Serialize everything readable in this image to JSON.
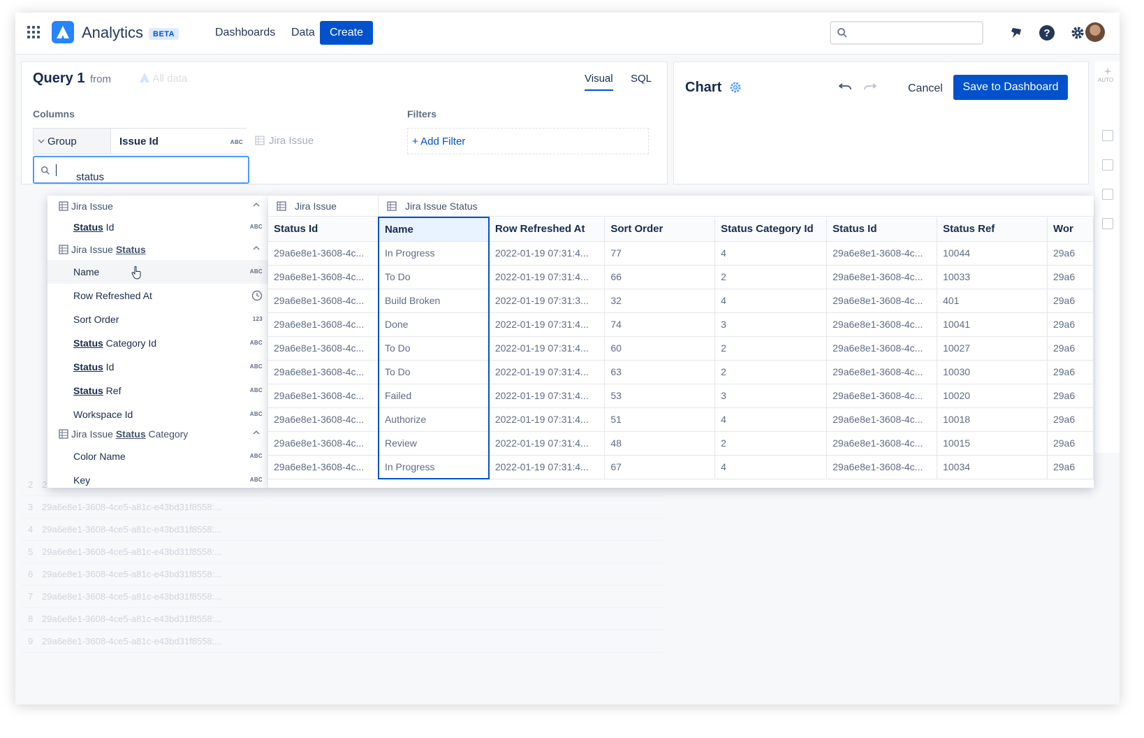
{
  "topbar": {
    "app_title": "Analytics",
    "beta_badge": "BETA",
    "nav": [
      "Dashboards",
      "Data"
    ],
    "create_label": "Create",
    "search_placeholder": ""
  },
  "query": {
    "title": "Query 1",
    "from_label": "from",
    "source_label": "All data",
    "tabs": [
      "Visual",
      "SQL"
    ],
    "active_tab": "Visual",
    "columns_label": "Columns",
    "filters_label": "Filters",
    "group_label": "Group",
    "column_name": "Issue Id",
    "column_type": "ABC",
    "ghost_source": "Jira Issue",
    "add_filter_label": "+ Add Filter",
    "search_value": "status"
  },
  "chart": {
    "title": "Chart",
    "cancel_label": "Cancel",
    "save_label": "Save to Dashboard",
    "rail_auto": "AUTO"
  },
  "dropdown": {
    "groups": [
      {
        "pre": "Jira Issue",
        "hl": "",
        "post": ""
      },
      {
        "pre": "Jira Issue ",
        "hl": "Status",
        "post": ""
      },
      {
        "pre": "Jira Issue ",
        "hl": "Status",
        "post": " Category"
      }
    ],
    "items": [
      {
        "hl": "Status",
        "post": " Id",
        "type": "ABC"
      },
      {
        "hl": "",
        "post": "Name",
        "type": "ABC"
      },
      {
        "hl": "",
        "post": "Row Refreshed At",
        "type": "clock"
      },
      {
        "hl": "",
        "post": "Sort Order",
        "type": "123"
      },
      {
        "hl": "Status",
        "post": " Category Id",
        "type": "ABC"
      },
      {
        "hl": "Status",
        "post": " Id",
        "type": "ABC"
      },
      {
        "hl": "Status",
        "post": " Ref",
        "type": "ABC"
      },
      {
        "hl": "",
        "post": "Workspace Id",
        "type": "ABC"
      },
      {
        "hl": "",
        "post": "Color Name",
        "type": "ABC"
      },
      {
        "hl": "",
        "post": "Key",
        "type": "ABC"
      }
    ]
  },
  "preview": {
    "sources": [
      "Jira Issue",
      "Jira Issue Status"
    ],
    "headers": [
      "Status Id",
      "Name",
      "Row Refreshed At",
      "Sort Order",
      "Status Category Id",
      "Status Id",
      "Status Ref",
      "Wor"
    ],
    "rows": [
      [
        "29a6e8e1-3608-4c...",
        "In Progress",
        "2022-01-19 07:31:4...",
        "77",
        "4",
        "29a6e8e1-3608-4c...",
        "10044",
        "29a6"
      ],
      [
        "29a6e8e1-3608-4c...",
        "To Do",
        "2022-01-19 07:31:4...",
        "66",
        "2",
        "29a6e8e1-3608-4c...",
        "10033",
        "29a6"
      ],
      [
        "29a6e8e1-3608-4c...",
        "Build Broken",
        "2022-01-19 07:31:3...",
        "32",
        "4",
        "29a6e8e1-3608-4c...",
        "401",
        "29a6"
      ],
      [
        "29a6e8e1-3608-4c...",
        "Done",
        "2022-01-19 07:31:4...",
        "74",
        "3",
        "29a6e8e1-3608-4c...",
        "10041",
        "29a6"
      ],
      [
        "29a6e8e1-3608-4c...",
        "To Do",
        "2022-01-19 07:31:4...",
        "60",
        "2",
        "29a6e8e1-3608-4c...",
        "10027",
        "29a6"
      ],
      [
        "29a6e8e1-3608-4c...",
        "To Do",
        "2022-01-19 07:31:4...",
        "63",
        "2",
        "29a6e8e1-3608-4c...",
        "10030",
        "29a6"
      ],
      [
        "29a6e8e1-3608-4c...",
        "Failed",
        "2022-01-19 07:31:4...",
        "53",
        "3",
        "29a6e8e1-3608-4c...",
        "10020",
        "29a6"
      ],
      [
        "29a6e8e1-3608-4c...",
        "Authorize",
        "2022-01-19 07:31:4...",
        "51",
        "4",
        "29a6e8e1-3608-4c...",
        "10018",
        "29a6"
      ],
      [
        "29a6e8e1-3608-4c...",
        "Review",
        "2022-01-19 07:31:4...",
        "48",
        "2",
        "29a6e8e1-3608-4c...",
        "10015",
        "29a6"
      ],
      [
        "29a6e8e1-3608-4c...",
        "In Progress",
        "2022-01-19 07:31:4...",
        "67",
        "4",
        "29a6e8e1-3608-4c...",
        "10034",
        "29a6"
      ]
    ]
  },
  "background_rows": [
    {
      "n": "2",
      "v": "29a6e8e1-3608-4ce5-a81c-e43bd31f8558:..."
    },
    {
      "n": "3",
      "v": "29a6e8e1-3608-4ce5-a81c-e43bd31f8558:..."
    },
    {
      "n": "4",
      "v": "29a6e8e1-3608-4ce5-a81c-e43bd31f8558:..."
    },
    {
      "n": "5",
      "v": "29a6e8e1-3608-4ce5-a81c-e43bd31f8558:..."
    },
    {
      "n": "6",
      "v": "29a6e8e1-3608-4ce5-a81c-e43bd31f8558:..."
    },
    {
      "n": "7",
      "v": "29a6e8e1-3608-4ce5-a81c-e43bd31f8558:..."
    },
    {
      "n": "8",
      "v": "29a6e8e1-3608-4ce5-a81c-e43bd31f8558:..."
    },
    {
      "n": "9",
      "v": "29a6e8e1-3608-4ce5-a81c-e43bd31f8558:..."
    }
  ],
  "colors": {
    "primary": "#0052cc",
    "focus": "#4c9aff",
    "logo": "#2684ff"
  }
}
